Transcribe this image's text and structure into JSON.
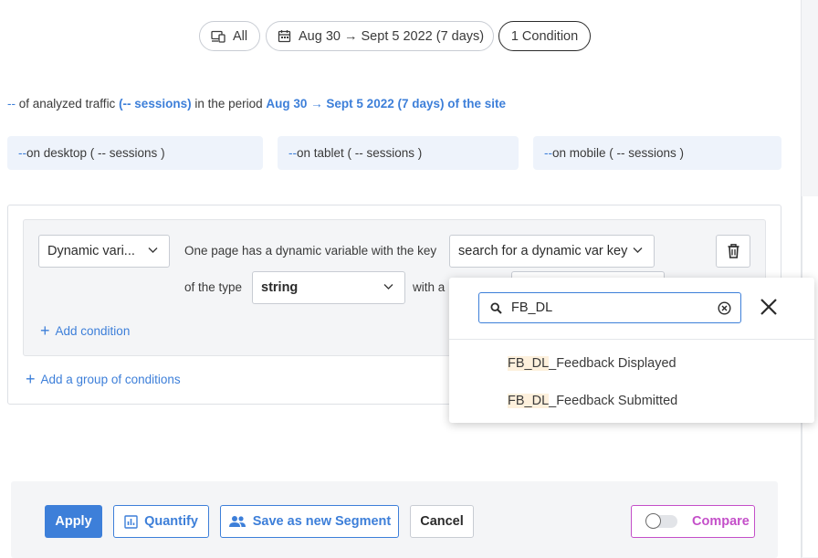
{
  "filters": {
    "devices": "All",
    "period": "Aug 30 → Sept 5 2022 (7 days)",
    "conditions": "1 Condition"
  },
  "traffic": {
    "placeholder": "--",
    "text_a": " of analyzed traffic ",
    "sessions_link": "(-- sessions)",
    "text_b": " in the period ",
    "period_link": "Aug 30 → Sept 5 2022 (7 days) of the site"
  },
  "devices_breakdown": [
    {
      "dash": "--",
      "label": " on desktop ( -- sessions )"
    },
    {
      "dash": "--",
      "label": " on tablet ( -- sessions )"
    },
    {
      "dash": "--",
      "label": " on mobile ( -- sessions )"
    }
  ],
  "condition": {
    "type_select": "Dynamic vari...",
    "key_text": "One page has a dynamic variable with the key",
    "key_select": "search for a dynamic var key",
    "of_type_text": "of the type",
    "type_value": "string",
    "with_a_text": "with a",
    "add_condition": "Add condition",
    "add_group": "Add a group of conditions"
  },
  "dropdown": {
    "search_value": "FB_DL",
    "options": [
      {
        "match": "FB_DL",
        "rest": "_Feedback Displayed"
      },
      {
        "match": "FB_DL",
        "rest": "_Feedback Submitted"
      }
    ]
  },
  "footer": {
    "apply": "Apply",
    "quantify": "Quantify",
    "save_segment": "Save as new Segment",
    "cancel": "Cancel",
    "compare": "Compare",
    "compare_enabled": false
  },
  "colors": {
    "accent": "#3d7fd9",
    "compare": "#c44fc9",
    "highlight": "#fdf0dc"
  }
}
